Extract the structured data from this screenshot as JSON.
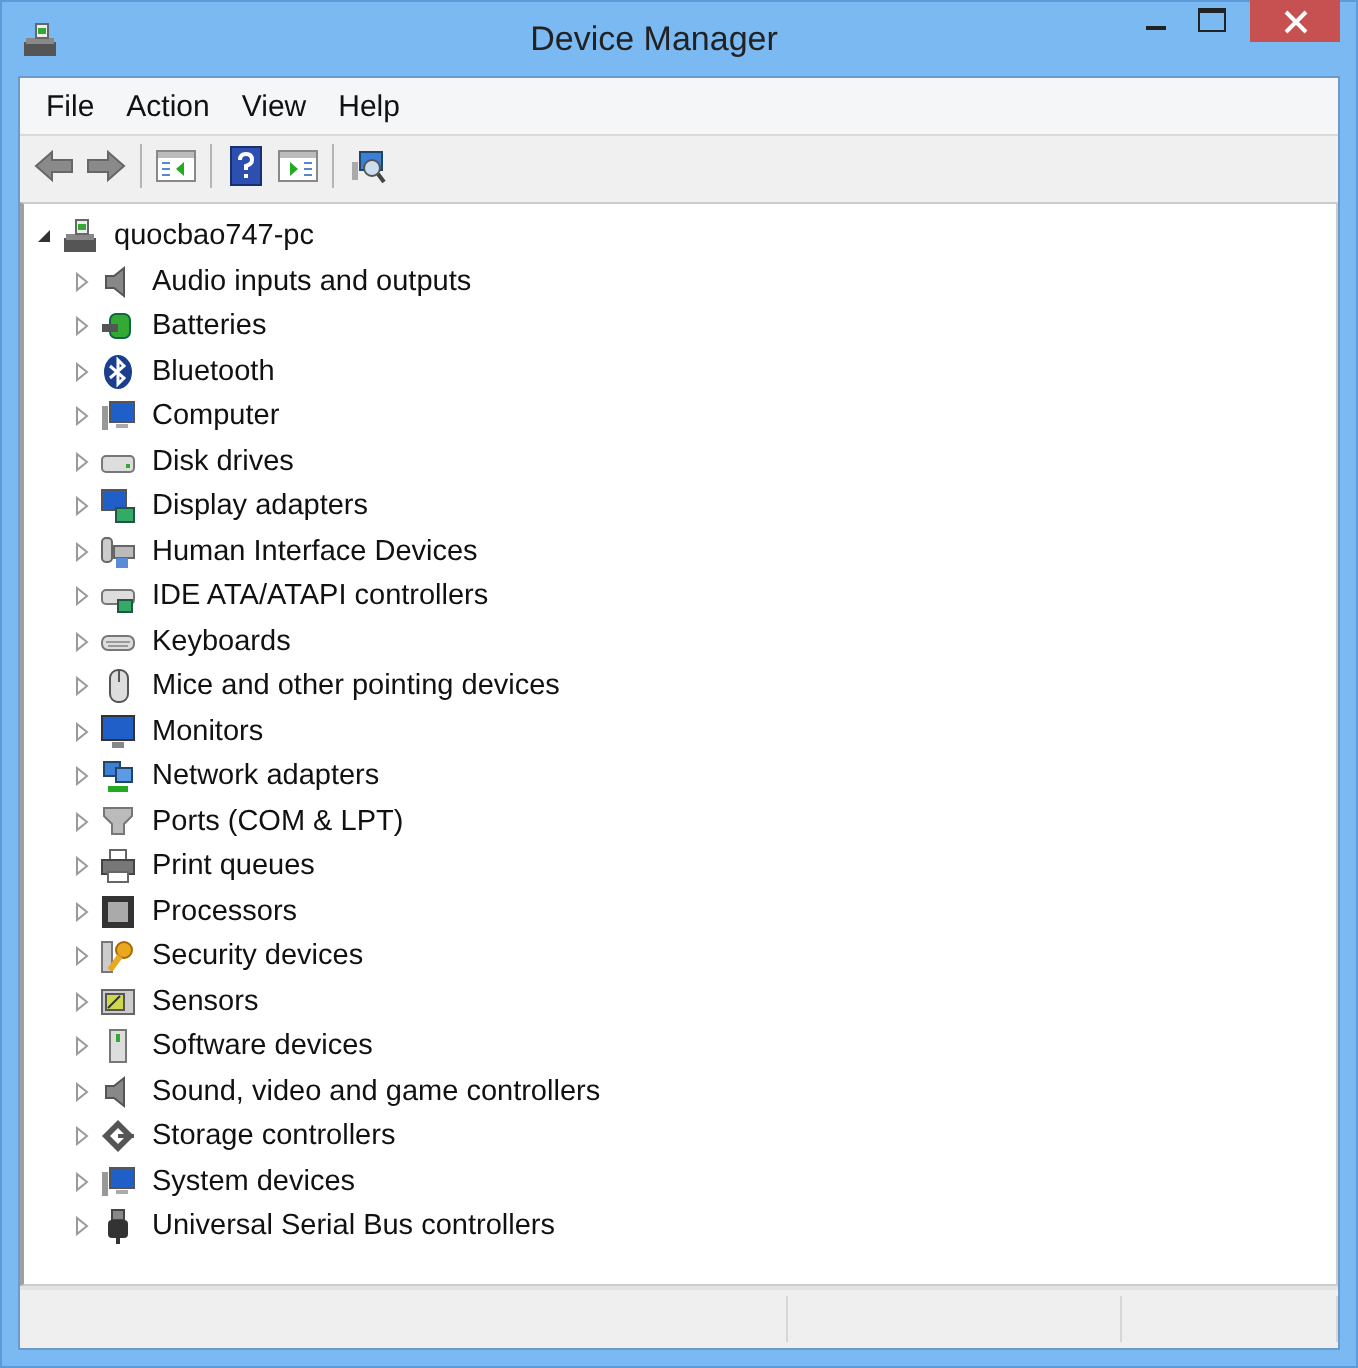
{
  "window": {
    "title": "Device Manager"
  },
  "menu": [
    "File",
    "Action",
    "View",
    "Help"
  ],
  "tree": {
    "label": "quocbao747-pc",
    "expanded": true,
    "children": [
      {
        "label": "Audio inputs and outputs",
        "expanded": false
      },
      {
        "label": "Batteries",
        "expanded": false
      },
      {
        "label": "Bluetooth",
        "expanded": false
      },
      {
        "label": "Computer",
        "expanded": false
      },
      {
        "label": "Disk drives",
        "expanded": false
      },
      {
        "label": "Display adapters",
        "expanded": false
      },
      {
        "label": "Human Interface Devices",
        "expanded": false
      },
      {
        "label": "IDE ATA/ATAPI controllers",
        "expanded": false
      },
      {
        "label": "Keyboards",
        "expanded": false
      },
      {
        "label": "Mice and other pointing devices",
        "expanded": false
      },
      {
        "label": "Monitors",
        "expanded": false
      },
      {
        "label": "Network adapters",
        "expanded": false
      },
      {
        "label": "Ports (COM & LPT)",
        "expanded": false
      },
      {
        "label": "Print queues",
        "expanded": false
      },
      {
        "label": "Processors",
        "expanded": false
      },
      {
        "label": "Security devices",
        "expanded": false
      },
      {
        "label": "Sensors",
        "expanded": false
      },
      {
        "label": "Software devices",
        "expanded": false
      },
      {
        "label": "Sound, video and game controllers",
        "expanded": false
      },
      {
        "label": "Storage controllers",
        "expanded": false
      },
      {
        "label": "System devices",
        "expanded": false
      },
      {
        "label": "Universal Serial Bus controllers",
        "expanded": false
      }
    ]
  }
}
